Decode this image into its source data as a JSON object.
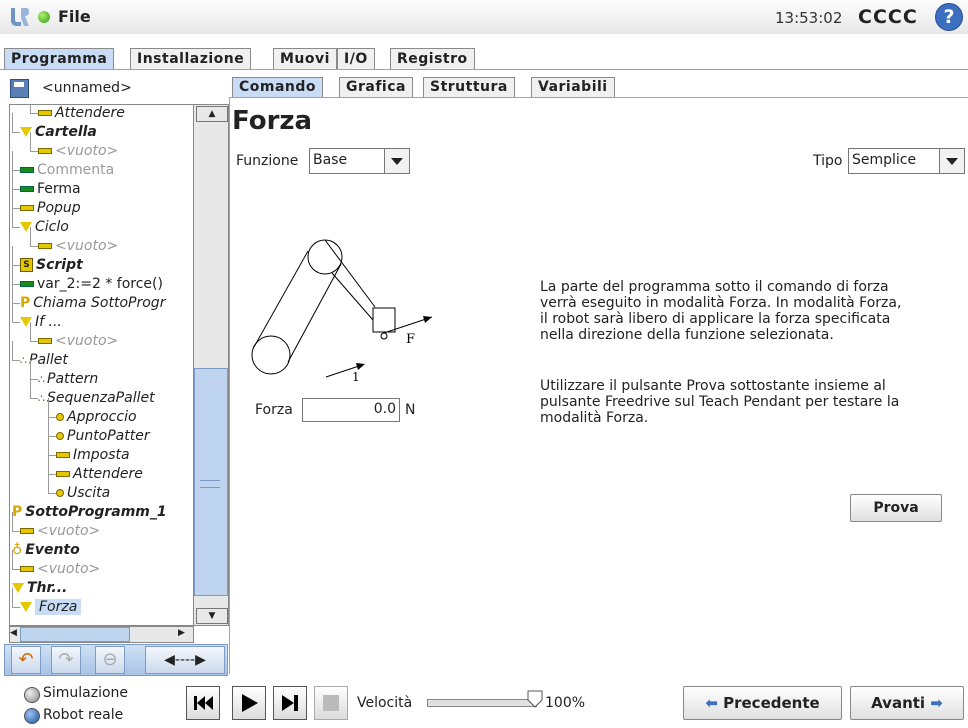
{
  "topbar": {
    "file_label": "File",
    "clock": "13:53:02",
    "robot_name": "CCCC",
    "help_symbol": "?"
  },
  "main_tabs": [
    {
      "label": "Programma",
      "active": true
    },
    {
      "label": "Installazione",
      "active": false
    },
    {
      "label": "Muovi",
      "active": false
    },
    {
      "label": "I/O",
      "active": false
    },
    {
      "label": "Registro",
      "active": false
    }
  ],
  "program": {
    "name": "<unnamed>"
  },
  "tree": [
    {
      "label": "Attendere",
      "icon": "dash-yellow",
      "style": "italic"
    },
    {
      "label": "Cartella",
      "icon": "triangle",
      "style": "bold-italic"
    },
    {
      "label": "<vuoto>",
      "icon": "dash-yellow",
      "style": "gray"
    },
    {
      "label": "Commenta",
      "icon": "dash-green",
      "style": "gray-normal"
    },
    {
      "label": "Ferma",
      "icon": "dash-green",
      "style": "normal"
    },
    {
      "label": "Popup",
      "icon": "dash-yellow",
      "style": "italic"
    },
    {
      "label": "Ciclo",
      "icon": "triangle",
      "style": "italic"
    },
    {
      "label": "<vuoto>",
      "icon": "dash-yellow",
      "style": "gray"
    },
    {
      "label": "Script",
      "icon": "script",
      "style": "bold-italic"
    },
    {
      "label": "var_2:=2 * force()",
      "icon": "dash-green",
      "style": "normal"
    },
    {
      "label": "Chiama SottoProgr",
      "icon": "p",
      "style": "italic"
    },
    {
      "label": "If ...",
      "icon": "triangle",
      "style": "italic"
    },
    {
      "label": "<vuoto>",
      "icon": "dash-yellow",
      "style": "gray"
    },
    {
      "label": "Pallet",
      "icon": "pallet",
      "style": "italic"
    },
    {
      "label": "Pattern",
      "icon": "pallet",
      "style": "italic"
    },
    {
      "label": "SequenzaPallet",
      "icon": "pallet",
      "style": "italic"
    },
    {
      "label": "Approccio",
      "icon": "dot",
      "style": "italic"
    },
    {
      "label": "PuntoPatter",
      "icon": "dot",
      "style": "italic"
    },
    {
      "label": "Imposta",
      "icon": "dash-yellow",
      "style": "italic"
    },
    {
      "label": "Attendere",
      "icon": "dash-yellow",
      "style": "italic"
    },
    {
      "label": "Uscita",
      "icon": "dot",
      "style": "italic"
    },
    {
      "label": "SottoProgramm_1",
      "icon": "p",
      "style": "bold-italic"
    },
    {
      "label": "<vuoto>",
      "icon": "dash-yellow",
      "style": "gray"
    },
    {
      "label": "Evento",
      "icon": "event",
      "style": "bold-italic"
    },
    {
      "label": "<vuoto>",
      "icon": "dash-yellow",
      "style": "gray"
    },
    {
      "label": "Thr...",
      "icon": "triangle",
      "style": "bold-italic"
    },
    {
      "label": "Forza",
      "icon": "triangle",
      "style": "italic-selected"
    }
  ],
  "sub_tabs": [
    {
      "label": "Comando",
      "active": true
    },
    {
      "label": "Grafica",
      "active": false
    },
    {
      "label": "Struttura",
      "active": false
    },
    {
      "label": "Variabili",
      "active": false
    }
  ],
  "command": {
    "title": "Forza",
    "funzione_label": "Funzione",
    "funzione_value": "Base",
    "tipo_label": "Tipo",
    "tipo_value": "Semplice",
    "diagram_label_f": "F",
    "diagram_label_1": "1",
    "forza_label": "Forza",
    "forza_value": "0.0",
    "forza_unit": "N",
    "description_1": "La parte del programma sotto il comando di forza verrà eseguito in modalità Forza. In modalità Forza, il robot sarà libero di applicare la forza specificata nella direzione della funzione selezionata.",
    "description_2": "Utilizzare il pulsante Prova sottostante insieme al pulsante Freedrive sul Teach Pendant per testare la modalità Forza.",
    "test_button": "Prova"
  },
  "bottombar": {
    "simulation_label": "Simulazione",
    "real_robot_label": "Robot reale",
    "speed_label": "Velocità",
    "speed_value": "100%",
    "speed_fraction": 1.0,
    "prev_button": "Precedente",
    "next_button": "Avanti"
  },
  "colors": {
    "active_tab": "#c9dcf5",
    "accent": "#3b6fc0",
    "green": "#1a8a1a",
    "yellow": "#e6c800"
  }
}
